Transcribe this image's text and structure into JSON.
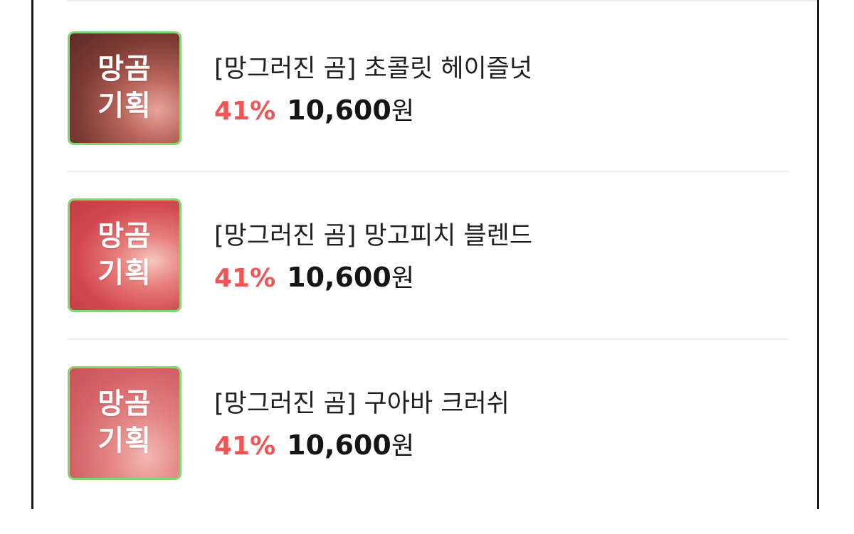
{
  "products": [
    {
      "thumb_line1": "망곰",
      "thumb_line2": "기획",
      "thumb_color": "#8a4a42",
      "title": "[망그러진 곰] 초콜릿 헤이즐넛",
      "discount": "41%",
      "price": "10,600",
      "currency": "원"
    },
    {
      "thumb_line1": "망곰",
      "thumb_line2": "기획",
      "thumb_color": "#d8555a",
      "title": "[망그러진 곰] 망고피치 블렌드",
      "discount": "41%",
      "price": "10,600",
      "currency": "원"
    },
    {
      "thumb_line1": "망곰",
      "thumb_line2": "기획",
      "thumb_color": "#d9676b",
      "title": "[망그러진 곰] 구아바 크러쉬",
      "discount": "41%",
      "price": "10,600",
      "currency": "원"
    }
  ],
  "colors": {
    "discount": "#f05454",
    "thumb_border": "#7fd870",
    "divider": "#ececec"
  }
}
